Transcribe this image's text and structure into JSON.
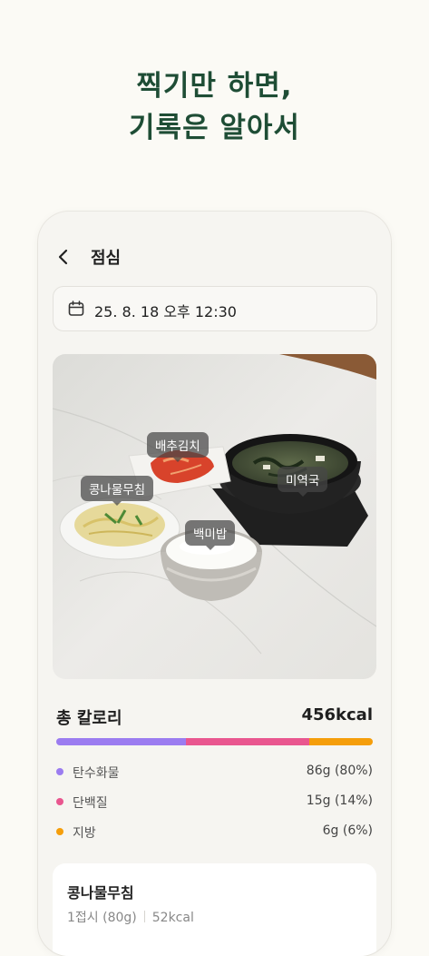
{
  "headline": {
    "line1": "찍기만 하면,",
    "line2": "기록은 알아서"
  },
  "screen": {
    "title": "점심",
    "datetime": "25. 8. 18 오후 12:30",
    "food_tags": {
      "kimchi": "배추김치",
      "seaweed_soup": "미역국",
      "bean_sprouts": "콩나물무침",
      "rice": "백미밥"
    },
    "calories": {
      "label": "총 칼로리",
      "value": "456kcal"
    },
    "macros": [
      {
        "name": "탄수화물",
        "value": "86g (80%)",
        "color": "#9b7cf0",
        "share": 0.41
      },
      {
        "name": "단백질",
        "value": "15g (14%)",
        "color": "#e9568f",
        "share": 0.39
      },
      {
        "name": "지방",
        "value": "6g (6%)",
        "color": "#f59e0b",
        "share": 0.2
      }
    ],
    "food_card": {
      "name": "콩나물무침",
      "serving": "1접시 (80g)",
      "kcal": "52kcal"
    }
  }
}
